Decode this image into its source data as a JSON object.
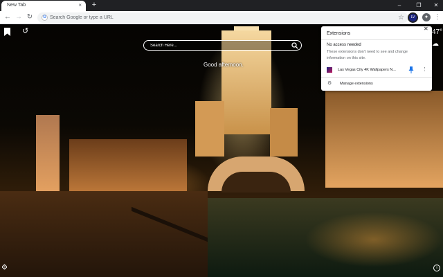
{
  "tab": {
    "title": "New Tab",
    "close_glyph": "×"
  },
  "new_tab_glyph": "+",
  "window_controls": {
    "minimize": "–",
    "restore": "❐",
    "close": "✕"
  },
  "toolbar": {
    "back_glyph": "←",
    "forward_glyph": "→",
    "reload_glyph": "↻",
    "omnibox_placeholder": "Search Google or type a URL",
    "star_glyph": "☆",
    "extension_badge": "LV",
    "menu_glyph": "⋮"
  },
  "page": {
    "search_placeholder": "Search Here...",
    "greeting": "Good afternoon.",
    "temperature": "47°",
    "weather_glyph": "☁",
    "history_glyph": "↺",
    "settings_glyph": "⚙",
    "info_glyph": "i"
  },
  "extensions_popup": {
    "title": "Extensions",
    "close_glyph": "✕",
    "subtitle": "No access needed",
    "description": "These extensions don't need to see and change information on this site.",
    "extension_name": "Las Vegas City 4K Wallpapers N...",
    "more_glyph": "⋮",
    "manage_glyph": "⚙",
    "manage_label": "Manage extensions"
  },
  "colors": {
    "tabstrip_bg": "#202124",
    "toolbar_bg": "#ffffff",
    "omnibox_bg": "#f1f3f4",
    "pin_blue": "#1a73e8"
  },
  "icons": [
    "close-icon",
    "plus-icon",
    "back-icon",
    "forward-icon",
    "reload-icon",
    "google-icon",
    "star-icon",
    "puzzle-icon",
    "more-icon",
    "bookmark-icon",
    "history-icon",
    "search-icon",
    "weather-icon",
    "gear-icon",
    "info-icon",
    "pin-icon"
  ]
}
